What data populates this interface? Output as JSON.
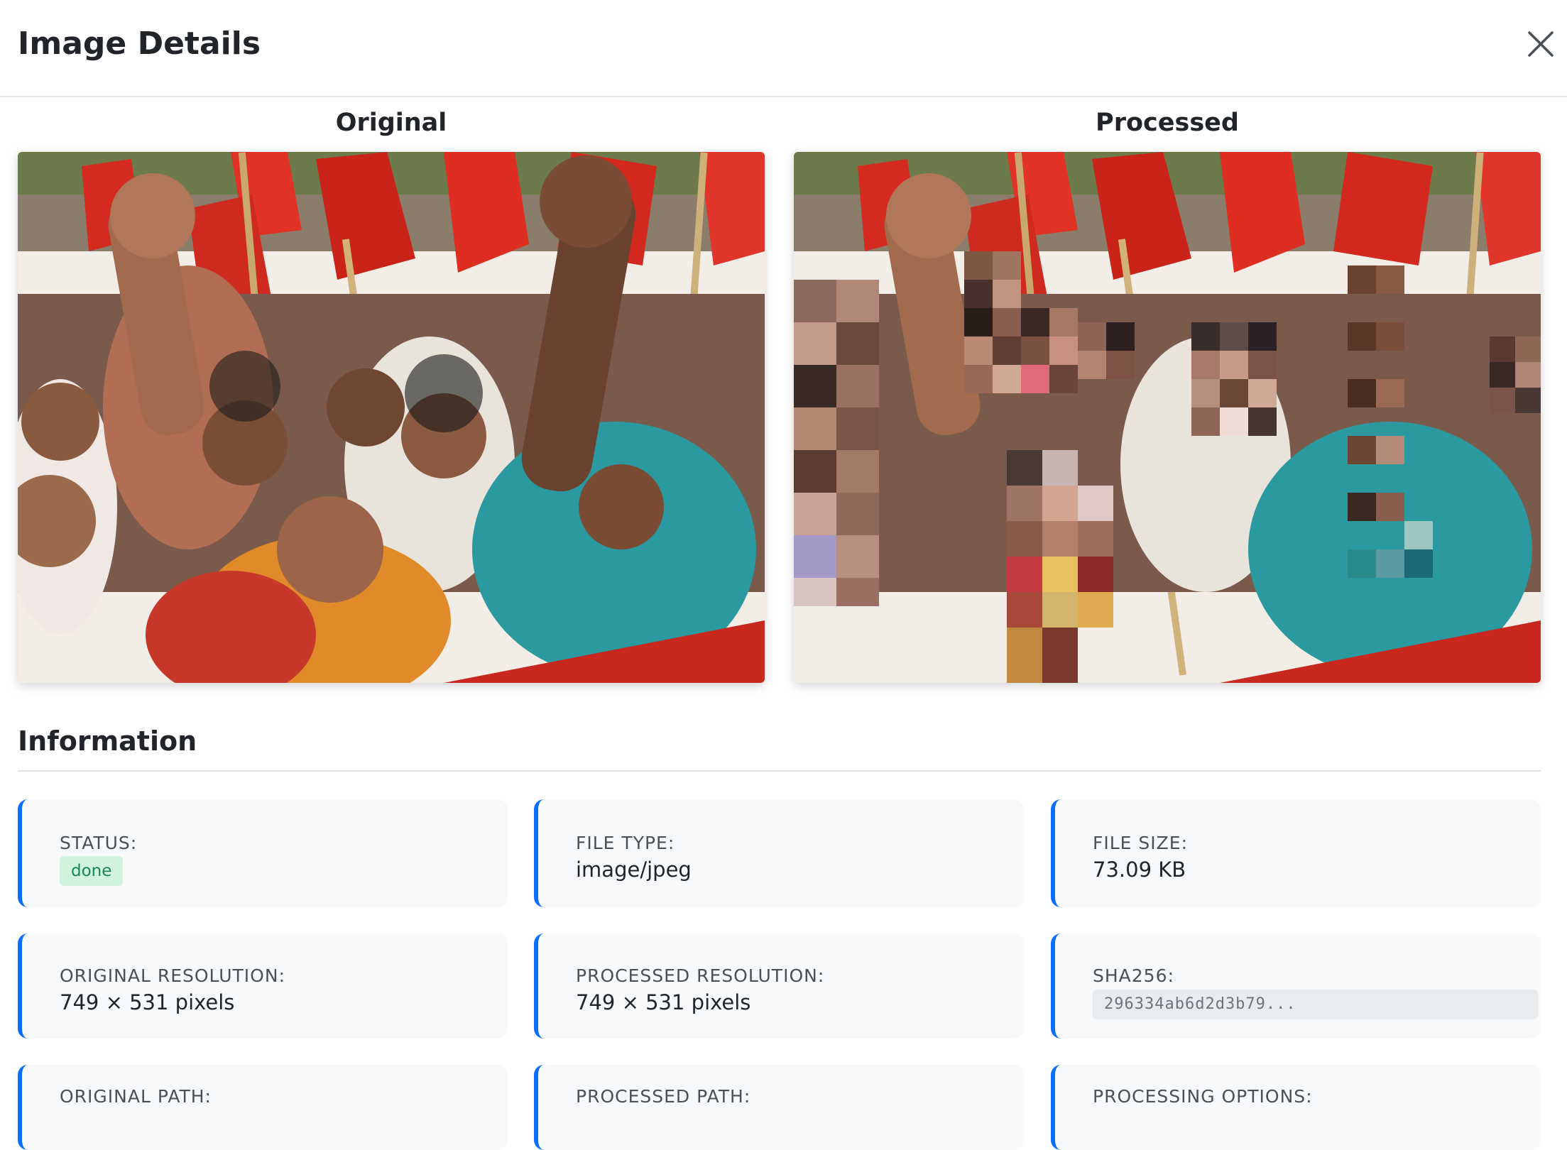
{
  "modal": {
    "title": "Image Details",
    "close_icon": "close-icon"
  },
  "images": {
    "original_label": "Original",
    "processed_label": "Processed"
  },
  "information": {
    "title": "Information",
    "status_label": "STATUS:",
    "status_value": "done",
    "file_type_label": "FILE TYPE:",
    "file_type_value": "image/jpeg",
    "file_size_label": "FILE SIZE:",
    "file_size_value": "73.09 KB",
    "original_resolution_label": "ORIGINAL RESOLUTION:",
    "original_resolution_value": "749 × 531 pixels",
    "processed_resolution_label": "PROCESSED RESOLUTION:",
    "processed_resolution_value": "749 × 531 pixels",
    "sha256_label": "SHA256:",
    "sha256_value": "296334ab6d2d3b79...",
    "original_path_label": "ORIGINAL PATH:",
    "processed_path_label": "PROCESSED PATH:",
    "processing_options_label": "PROCESSING OPTIONS:"
  },
  "colors": {
    "accent": "#0d6efd",
    "status_done_bg": "#d1f2dc",
    "status_done_text": "#198754"
  }
}
